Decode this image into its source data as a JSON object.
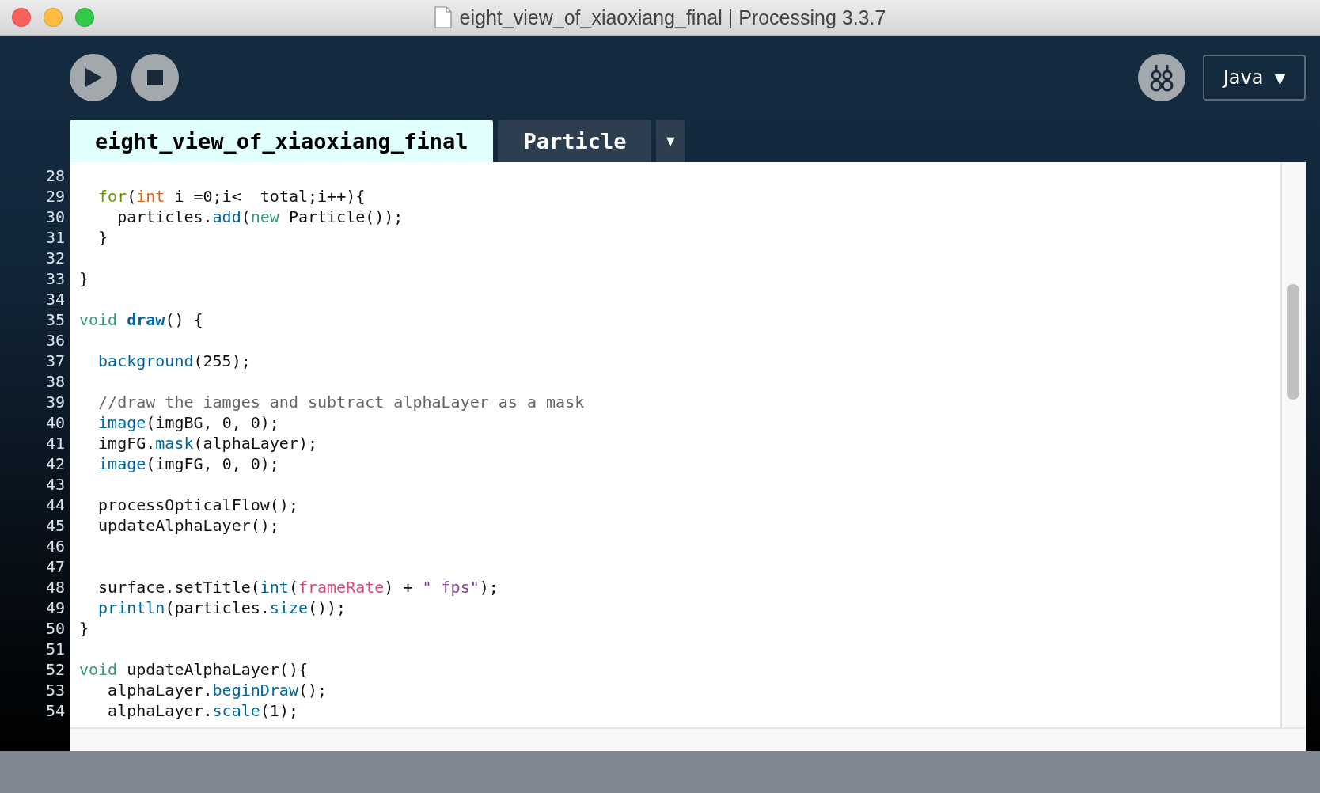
{
  "window": {
    "title": "eight_view_of_xiaoxiang_final | Processing 3.3.7"
  },
  "toolbar": {
    "mode": "Java",
    "mode_arrow": "▼"
  },
  "tabs": [
    {
      "label": "eight_view_of_xiaoxiang_final",
      "selected": true
    },
    {
      "label": "Particle",
      "selected": false
    }
  ],
  "tab_menu": "▼",
  "code_lines": [
    {
      "number": "28"
    },
    {
      "number": "29",
      "tokens": [
        {
          "kind": "control",
          "text": "  for"
        },
        {
          "kind": "plain",
          "text": "("
        },
        {
          "kind": "type",
          "text": "int"
        },
        {
          "kind": "plain",
          "text": " i =0;i<  total;i++){"
        }
      ]
    },
    {
      "number": "30",
      "tokens": [
        {
          "kind": "plain",
          "text": "    particles."
        },
        {
          "kind": "function",
          "text": "add"
        },
        {
          "kind": "plain",
          "text": "("
        },
        {
          "kind": "keyword",
          "text": "new"
        },
        {
          "kind": "plain",
          "text": " Particle());"
        }
      ]
    },
    {
      "number": "31",
      "tokens": [
        {
          "kind": "plain",
          "text": "  }"
        }
      ]
    },
    {
      "number": "32"
    },
    {
      "number": "33",
      "tokens": [
        {
          "kind": "plain",
          "text": "}"
        }
      ]
    },
    {
      "number": "34"
    },
    {
      "number": "35",
      "tokens": [
        {
          "kind": "keyword",
          "text": "void "
        },
        {
          "kind": "definition",
          "text": "draw"
        },
        {
          "kind": "plain",
          "text": "() {"
        }
      ]
    },
    {
      "number": "36"
    },
    {
      "number": "37",
      "tokens": [
        {
          "kind": "function",
          "text": "  background"
        },
        {
          "kind": "plain",
          "text": "(255);"
        }
      ]
    },
    {
      "number": "38"
    },
    {
      "number": "39",
      "tokens": [
        {
          "kind": "comment",
          "text": "  //draw the iamges and subtract alphaLayer as a mask"
        }
      ]
    },
    {
      "number": "40",
      "tokens": [
        {
          "kind": "function",
          "text": "  image"
        },
        {
          "kind": "plain",
          "text": "(imgBG, 0, 0);"
        }
      ]
    },
    {
      "number": "41",
      "tokens": [
        {
          "kind": "plain",
          "text": "  imgFG."
        },
        {
          "kind": "function",
          "text": "mask"
        },
        {
          "kind": "plain",
          "text": "(alphaLayer);"
        }
      ]
    },
    {
      "number": "42",
      "tokens": [
        {
          "kind": "function",
          "text": "  image"
        },
        {
          "kind": "plain",
          "text": "(imgFG, 0, 0);"
        }
      ]
    },
    {
      "number": "43"
    },
    {
      "number": "44",
      "tokens": [
        {
          "kind": "plain",
          "text": "  processOpticalFlow();"
        }
      ]
    },
    {
      "number": "45",
      "tokens": [
        {
          "kind": "plain",
          "text": "  updateAlphaLayer();"
        }
      ]
    },
    {
      "number": "46"
    },
    {
      "number": "47"
    },
    {
      "number": "48",
      "tokens": [
        {
          "kind": "plain",
          "text": "  surface.setTitle("
        },
        {
          "kind": "function",
          "text": "int"
        },
        {
          "kind": "plain",
          "text": "("
        },
        {
          "kind": "variable",
          "text": "frameRate"
        },
        {
          "kind": "plain",
          "text": ") + "
        },
        {
          "kind": "string",
          "text": "\" fps\""
        },
        {
          "kind": "plain",
          "text": ");"
        }
      ]
    },
    {
      "number": "49",
      "tokens": [
        {
          "kind": "function",
          "text": "  println"
        },
        {
          "kind": "plain",
          "text": "(particles."
        },
        {
          "kind": "function",
          "text": "size"
        },
        {
          "kind": "plain",
          "text": "());"
        }
      ]
    },
    {
      "number": "50",
      "tokens": [
        {
          "kind": "plain",
          "text": "}"
        }
      ]
    },
    {
      "number": "51"
    },
    {
      "number": "52",
      "tokens": [
        {
          "kind": "keyword",
          "text": "void"
        },
        {
          "kind": "plain",
          "text": " updateAlphaLayer(){"
        }
      ]
    },
    {
      "number": "53",
      "tokens": [
        {
          "kind": "plain",
          "text": "   alphaLayer."
        },
        {
          "kind": "function",
          "text": "beginDraw"
        },
        {
          "kind": "plain",
          "text": "();"
        }
      ]
    },
    {
      "number": "54",
      "tokens": [
        {
          "kind": "plain",
          "text": "   alphaLayer."
        },
        {
          "kind": "function",
          "text": "scale"
        },
        {
          "kind": "plain",
          "text": "(1);"
        }
      ]
    }
  ]
}
